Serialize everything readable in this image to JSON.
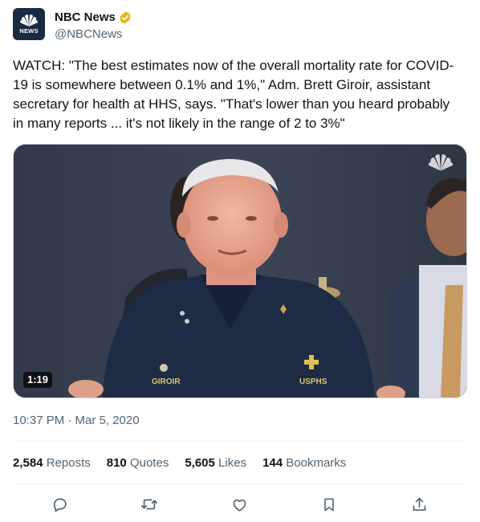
{
  "account": {
    "display_name": "NBC News",
    "handle": "@NBCNews",
    "avatar_text": "NEWS",
    "verified": true,
    "verified_color": "#e2b719"
  },
  "tweet": {
    "text": "WATCH: \"The best estimates now of the overall mortality rate for COVID-\n19 is somewhere between 0.1% and 1%,\" Adm. Brett Giroir, assistant\nsecretary for health at HHS, says. \"That's lower than you heard probably\nin many reports ... it's not likely in the range of 2 to 3%\"",
    "timestamp": "10:37 PM · Mar 5, 2020"
  },
  "media": {
    "type": "video",
    "duration": "1:19",
    "name_tag": "GIROIR",
    "insignia_text": "USPHS",
    "watermark": "nbc-peacock-icon"
  },
  "stats": [
    {
      "value": "2,584",
      "label": "Reposts"
    },
    {
      "value": "810",
      "label": "Quotes"
    },
    {
      "value": "5,605",
      "label": "Likes"
    },
    {
      "value": "144",
      "label": "Bookmarks"
    }
  ],
  "actions": [
    "reply-icon",
    "repost-icon",
    "like-icon",
    "bookmark-icon",
    "share-icon"
  ],
  "colors": {
    "text": "#0f1419",
    "secondary": "#536471",
    "divider": "#eff3f4",
    "avatar_bg": "#1a2a44"
  }
}
